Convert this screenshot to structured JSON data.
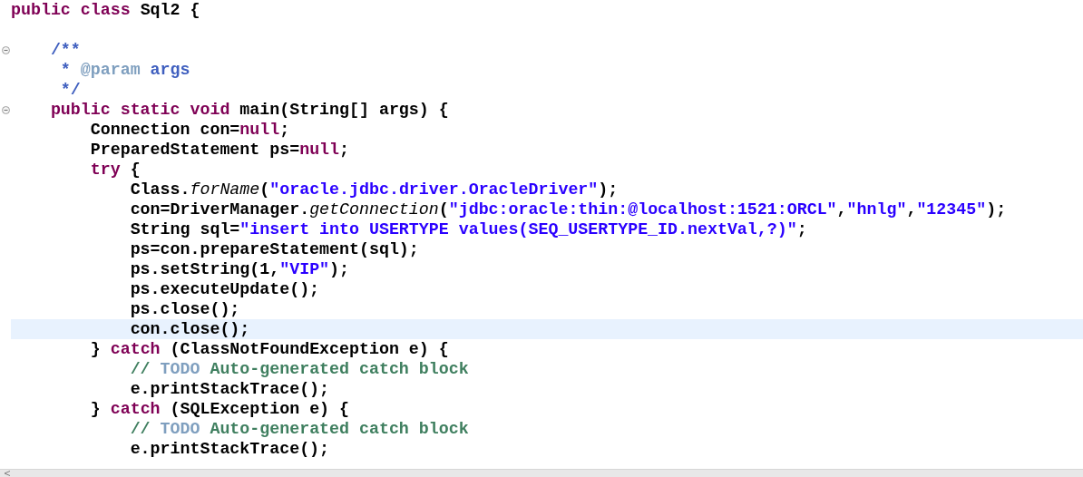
{
  "editor": {
    "lines": [
      {
        "current": false,
        "tokens": [
          {
            "kind": "kw",
            "text": "public class "
          },
          {
            "kind": "plain",
            "text": "Sql2 {"
          }
        ]
      },
      {
        "current": false
      },
      {
        "current": false,
        "collapsed": false,
        "tokens": [
          {
            "kind": "doc",
            "text": "    /**"
          }
        ]
      },
      {
        "current": false,
        "tokens": [
          {
            "kind": "doc",
            "text": "     * "
          },
          {
            "kind": "tag",
            "text": "@param"
          },
          {
            "kind": "doc",
            "text": " args"
          }
        ]
      },
      {
        "current": false,
        "tokens": [
          {
            "kind": "doc",
            "text": "     */"
          }
        ]
      },
      {
        "current": false,
        "collapsed": false,
        "tokens": [
          {
            "kind": "kw",
            "text": "    public static void "
          },
          {
            "kind": "plain",
            "text": "main(String[] args) {"
          }
        ]
      },
      {
        "current": false,
        "tokens": [
          {
            "kind": "plain",
            "text": "        Connection con="
          },
          {
            "kind": "kw",
            "text": "null"
          },
          {
            "kind": "plain",
            "text": ";"
          }
        ]
      },
      {
        "current": false,
        "tokens": [
          {
            "kind": "plain",
            "text": "        PreparedStatement ps="
          },
          {
            "kind": "kw",
            "text": "null"
          },
          {
            "kind": "plain",
            "text": ";"
          }
        ]
      },
      {
        "current": false,
        "tokens": [
          {
            "kind": "kw",
            "text": "        try "
          },
          {
            "kind": "plain",
            "text": "{"
          }
        ]
      },
      {
        "current": false,
        "tokens": [
          {
            "kind": "plain",
            "text": "            Class."
          },
          {
            "kind": "static",
            "text": "forName"
          },
          {
            "kind": "plain",
            "text": "("
          },
          {
            "kind": "str",
            "text": "\"oracle.jdbc.driver.OracleDriver\""
          },
          {
            "kind": "plain",
            "text": ");"
          }
        ]
      },
      {
        "current": false,
        "tokens": [
          {
            "kind": "plain",
            "text": "            con=DriverManager."
          },
          {
            "kind": "static",
            "text": "getConnection"
          },
          {
            "kind": "plain",
            "text": "("
          },
          {
            "kind": "str",
            "text": "\"jdbc:oracle:thin:@localhost:1521:ORCL\""
          },
          {
            "kind": "plain",
            "text": ","
          },
          {
            "kind": "str",
            "text": "\"hnlg\""
          },
          {
            "kind": "plain",
            "text": ","
          },
          {
            "kind": "str",
            "text": "\"12345\""
          },
          {
            "kind": "plain",
            "text": ");"
          }
        ]
      },
      {
        "current": false,
        "tokens": [
          {
            "kind": "plain",
            "text": "            String sql="
          },
          {
            "kind": "str",
            "text": "\"insert into USERTYPE values(SEQ_USERTYPE_ID.nextVal,?)\""
          },
          {
            "kind": "plain",
            "text": ";"
          }
        ]
      },
      {
        "current": false,
        "tokens": [
          {
            "kind": "plain",
            "text": "            ps=con.prepareStatement(sql);"
          }
        ]
      },
      {
        "current": false,
        "tokens": [
          {
            "kind": "plain",
            "text": "            ps.setString(1,"
          },
          {
            "kind": "str",
            "text": "\"VIP\""
          },
          {
            "kind": "plain",
            "text": ");"
          }
        ]
      },
      {
        "current": false,
        "tokens": [
          {
            "kind": "plain",
            "text": "            ps.executeUpdate();"
          }
        ]
      },
      {
        "current": false,
        "tokens": [
          {
            "kind": "plain",
            "text": "            ps.close();"
          }
        ]
      },
      {
        "current": true,
        "tokens": [
          {
            "kind": "plain",
            "text": "            con.close();"
          }
        ]
      },
      {
        "current": false,
        "tokens": [
          {
            "kind": "plain",
            "text": "        } "
          },
          {
            "kind": "kw",
            "text": "catch "
          },
          {
            "kind": "plain",
            "text": "(ClassNotFoundException e) {"
          }
        ]
      },
      {
        "current": false,
        "tokens": [
          {
            "kind": "comment",
            "text": "            // "
          },
          {
            "kind": "todo",
            "text": "TODO"
          },
          {
            "kind": "comment",
            "text": " Auto-generated catch block"
          }
        ]
      },
      {
        "current": false,
        "tokens": [
          {
            "kind": "plain",
            "text": "            e.printStackTrace();"
          }
        ]
      },
      {
        "current": false,
        "tokens": [
          {
            "kind": "plain",
            "text": "        } "
          },
          {
            "kind": "kw",
            "text": "catch "
          },
          {
            "kind": "plain",
            "text": "(SQLException e) {"
          }
        ]
      },
      {
        "current": false,
        "tokens": [
          {
            "kind": "comment",
            "text": "            // "
          },
          {
            "kind": "todo",
            "text": "TODO"
          },
          {
            "kind": "comment",
            "text": " Auto-generated catch block"
          }
        ]
      },
      {
        "current": false,
        "tokens": [
          {
            "kind": "plain",
            "text": "            e.printStackTrace();"
          }
        ]
      }
    ]
  }
}
